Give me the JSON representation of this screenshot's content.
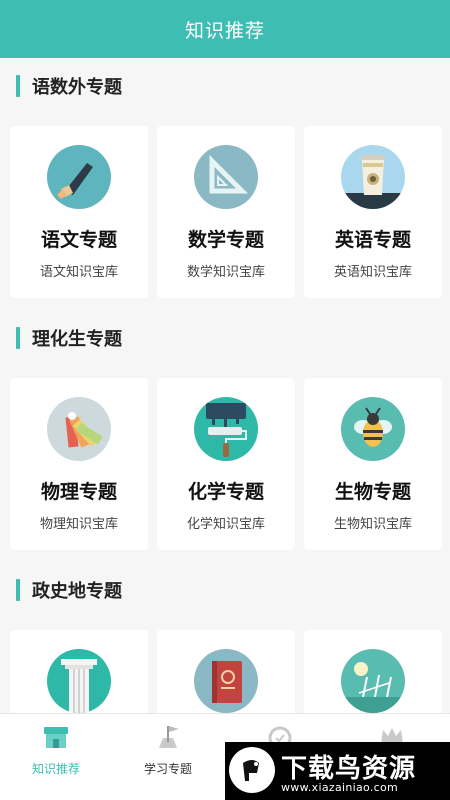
{
  "header": {
    "title": "知识推荐"
  },
  "sections": [
    {
      "title": "语数外专题",
      "cards": [
        {
          "title": "语文专题",
          "subtitle": "语文知识宝库",
          "icon": "paintbrush-icon"
        },
        {
          "title": "数学专题",
          "subtitle": "数学知识宝库",
          "icon": "set-square-icon"
        },
        {
          "title": "英语专题",
          "subtitle": "英语知识宝库",
          "icon": "coffee-cup-icon"
        }
      ]
    },
    {
      "title": "理化生专题",
      "cards": [
        {
          "title": "物理专题",
          "subtitle": "物理知识宝库",
          "icon": "color-swatch-icon"
        },
        {
          "title": "化学专题",
          "subtitle": "化学知识宝库",
          "icon": "paint-roller-icon"
        },
        {
          "title": "生物专题",
          "subtitle": "生物知识宝库",
          "icon": "bee-icon"
        }
      ]
    },
    {
      "title": "政史地专题",
      "cards": [
        {
          "icon": "column-icon"
        },
        {
          "icon": "notebook-icon"
        },
        {
          "icon": "wind-turbine-icon"
        }
      ]
    }
  ],
  "tabbar": {
    "items": [
      {
        "label": "知识推荐",
        "icon": "store-icon",
        "active": true
      },
      {
        "label": "学习专题",
        "icon": "flag-icon",
        "active": false
      },
      {
        "label": "",
        "icon": "alarm-clock-icon",
        "active": false
      },
      {
        "label": "",
        "icon": "crown-icon",
        "active": false
      }
    ]
  },
  "watermark": {
    "text": "下载鸟资源",
    "url": "www.xiazainiao.com"
  },
  "colors": {
    "accent": "#3ebdb3",
    "active_tab": "#3ebdb3"
  }
}
